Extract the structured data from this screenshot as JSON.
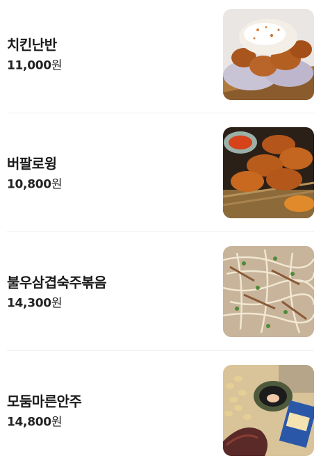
{
  "menu": {
    "items": [
      {
        "name": "치킨난반",
        "price": "11,000",
        "currency": "원",
        "photo": "chicken-nanban-photo"
      },
      {
        "name": "버팔로윙",
        "price": "10,800",
        "currency": "원",
        "photo": "buffalo-wings-photo"
      },
      {
        "name": "불우삼겹숙주볶음",
        "price": "14,300",
        "currency": "원",
        "photo": "pork-beansprout-stirfry-photo"
      },
      {
        "name": "모둠마른안주",
        "price": "14,800",
        "currency": "원",
        "photo": "dried-snack-platter-photo"
      }
    ]
  }
}
